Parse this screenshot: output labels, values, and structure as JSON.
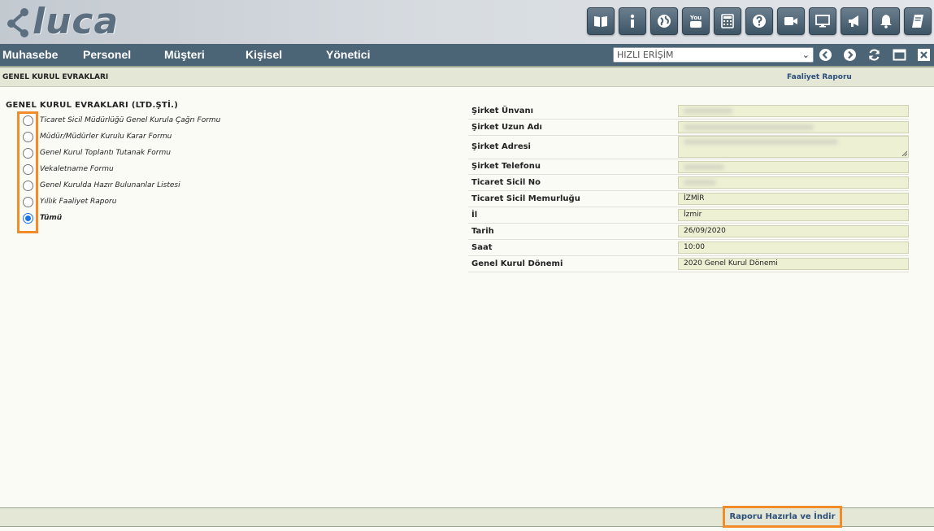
{
  "brand": {
    "logo_text": "luca"
  },
  "toolbar": {
    "icons": [
      "book-icon",
      "info-icon",
      "globe-icon",
      "youtube-icon",
      "calculator-icon",
      "help-icon",
      "video-camera-icon",
      "monitor-icon",
      "megaphone-icon",
      "bell-icon",
      "notebook-icon"
    ],
    "youtube_text": "You"
  },
  "menu": {
    "items": [
      {
        "label": "Muhasebe"
      },
      {
        "label": "Personel"
      },
      {
        "label": "Müşteri"
      },
      {
        "label": "Kişisel"
      },
      {
        "label": "Yönetici"
      }
    ],
    "quick_access": "HIZLI ERİŞİM"
  },
  "subheader": {
    "title": "GENEL KURUL EVRAKLARI",
    "report_link": "Faaliyet Raporu"
  },
  "form": {
    "title": "GENEL KURUL EVRAKLARI (LTD.ŞTİ.)",
    "options": [
      {
        "label": "Ticaret Sicil Müdürlüğü Genel Kurula Çağrı Formu",
        "selected": false
      },
      {
        "label": "Müdür/Müdürler Kurulu Karar Formu",
        "selected": false
      },
      {
        "label": "Genel Kurul Toplantı Tutanak Formu",
        "selected": false
      },
      {
        "label": "Vekaletname Formu",
        "selected": false
      },
      {
        "label": "Genel Kurulda Hazır Bulunanlar Listesi",
        "selected": false
      },
      {
        "label": "Yıllık Faaliyet Raporu",
        "selected": false
      },
      {
        "label": "Tümü",
        "selected": true
      }
    ]
  },
  "info": {
    "rows": [
      {
        "label": "Şirket Ünvanı",
        "value": ""
      },
      {
        "label": "Şirket Uzun Adı",
        "value": ""
      },
      {
        "label": "Şirket Adresi",
        "value": ""
      },
      {
        "label": "Şirket Telefonu",
        "value": ""
      },
      {
        "label": "Ticaret Sicil No",
        "value": ""
      },
      {
        "label": "Ticaret Sicil Memurluğu",
        "value": "İZMİR"
      },
      {
        "label": "İl",
        "value": "İzmir"
      },
      {
        "label": "Tarih",
        "value": "26/09/2020"
      },
      {
        "label": "Saat",
        "value": "10:00"
      },
      {
        "label": "Genel Kurul Dönemi",
        "value": "2020 Genel Kurul Dönemi"
      }
    ]
  },
  "footer": {
    "prepare_button": "Raporu Hazırla ve İndir"
  },
  "colors": {
    "menu_bg": "#4b6476",
    "highlight": "#f28c28",
    "field_bg": "#eef0d4",
    "link": "#2b4f7a"
  }
}
